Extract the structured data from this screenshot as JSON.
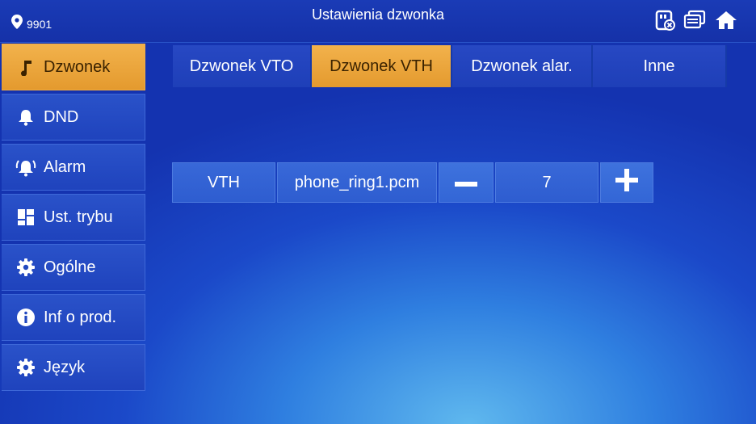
{
  "header": {
    "room_number": "9901",
    "title": "Ustawienia dzwonka",
    "icons": [
      "location-pin-icon",
      "sd-card-error-icon",
      "monitor-icon",
      "home-icon"
    ]
  },
  "sidebar": {
    "items": [
      {
        "label": "Dzwonek",
        "icon": "music-note-icon",
        "active": true
      },
      {
        "label": "DND",
        "icon": "bell-icon"
      },
      {
        "label": "Alarm",
        "icon": "alarm-bell-icon"
      },
      {
        "label": "Ust. trybu",
        "icon": "grid-icon"
      },
      {
        "label": "Ogólne",
        "icon": "gear-icon"
      },
      {
        "label": "Inf o prod.",
        "icon": "info-icon"
      },
      {
        "label": "Język",
        "icon": "gear-icon"
      }
    ]
  },
  "tabs": [
    {
      "label": "Dzwonek VTO"
    },
    {
      "label": "Dzwonek VTH",
      "active": true
    },
    {
      "label": "Dzwonek alar."
    },
    {
      "label": "Inne"
    }
  ],
  "ring_row": {
    "device": "VTH",
    "ringtone": "phone_ring1.pcm",
    "decrease": "minus-icon",
    "volume": "7",
    "increase": "plus-icon"
  },
  "colors": {
    "accent": "#e9a23a",
    "background": "#1b49c9"
  }
}
